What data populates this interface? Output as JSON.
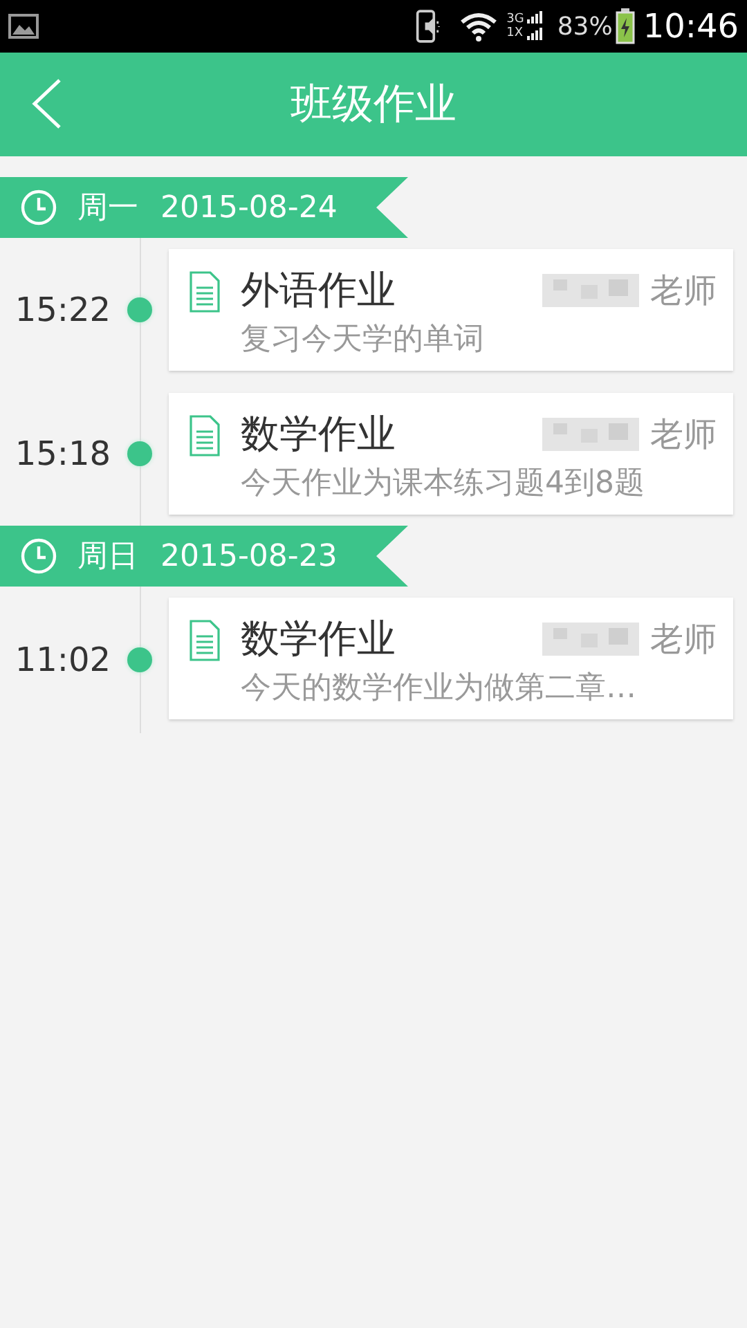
{
  "status_bar": {
    "network_top": "3G",
    "network_bottom": "1X",
    "battery": "83%",
    "time": "10:46"
  },
  "header": {
    "title": "班级作业"
  },
  "days": [
    {
      "weekday": "周一",
      "date": "2015-08-24",
      "items": [
        {
          "time": "15:22",
          "title": "外语作业",
          "teacher_suffix": "老师",
          "description": "复习今天学的单词"
        },
        {
          "time": "15:18",
          "title": "数学作业",
          "teacher_suffix": "老师",
          "description": "今天作业为课本练习题4到8题"
        }
      ]
    },
    {
      "weekday": "周日",
      "date": "2015-08-23",
      "items": [
        {
          "time": "11:02",
          "title": "数学作业",
          "teacher_suffix": "老师",
          "description": "今天的数学作业为做第二章…"
        }
      ]
    }
  ]
}
